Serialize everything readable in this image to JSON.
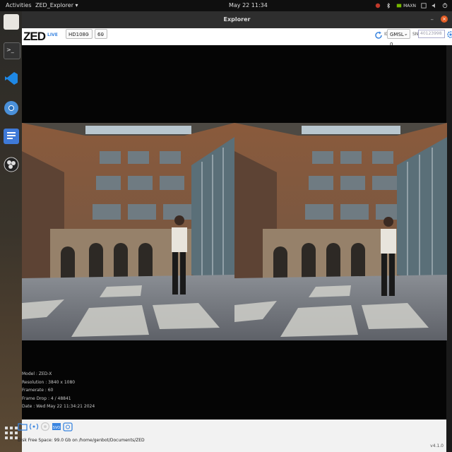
{
  "topbar": {
    "activities": "Activities",
    "app_menu": "ZED_Explorer ▾",
    "clock": "May 22  11:34",
    "power_mode": "MAXN"
  },
  "window": {
    "title": "Explorer",
    "close_symbol": "×",
    "minimize_symbol": "–"
  },
  "toolbar": {
    "logo": "ZED",
    "live_badge": "LIVE",
    "resolution": "HD1080",
    "fps": "60",
    "id_label": "ID",
    "camera_id": "GMSL - 0",
    "sn_label": "SN",
    "sn_placeholder": "40123998"
  },
  "info_overlay": {
    "model": "Model : ZED-X",
    "resolution": "Resolution : 3840 x 1080",
    "framerate": "Framerate : 60",
    "frame_drop": "Frame Drop : 4 / 48841",
    "date": "Date : Wed May 22 11:34:21 2024"
  },
  "bottom": {
    "disk_free": "Disk Free Space: 99.0 Gb  on  /home/genbot/Documents/ZED",
    "version": "v4.1.0"
  },
  "icons": [
    "files-icon",
    "terminal-icon",
    "vscode-icon",
    "chromium-icon",
    "document-icon",
    "obs-icon",
    "show-apps-icon",
    "folder-icon",
    "stream-icon",
    "record-icon",
    "svo-icon",
    "snapshot-icon",
    "refresh-icon",
    "settings-gear-icon"
  ],
  "colors": {
    "accent": "#3a85e0",
    "close": "#e35d25",
    "dark_bar": "#0f0f0f"
  }
}
